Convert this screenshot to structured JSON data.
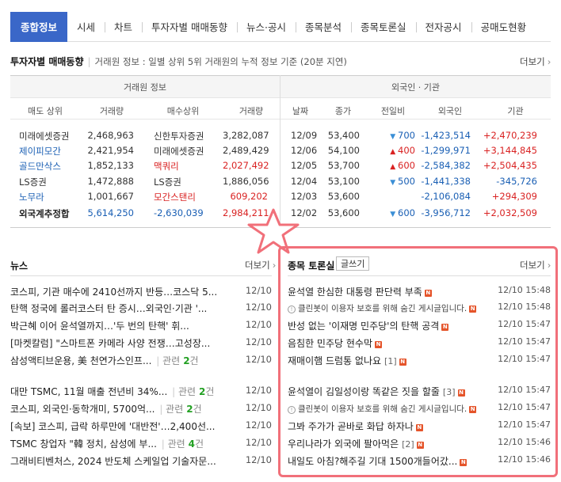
{
  "tabs": [
    "종합정보",
    "시세",
    "차트",
    "투자자별 매매동향",
    "뉴스·공시",
    "종목분석",
    "종목토론실",
    "전자공시",
    "공매도현황"
  ],
  "investor": {
    "title": "투자자별 매매동향",
    "desc": "거래원 정보 : 일별 상위 5위 거래원의 누적 정보 기준 (20분 지연)",
    "more": "더보기",
    "left_header": "거래원 정보",
    "right_header": "외국인 · 기관",
    "cols_left": [
      "매도 상위",
      "거래량",
      "매수상위",
      "거래량"
    ],
    "cols_right": [
      "날짜",
      "종가",
      "전일비",
      "외국인",
      "기관"
    ],
    "broker_rows": [
      {
        "sell": "미래에셋증권",
        "sv": "2,468,963",
        "buy": "신한투자증권",
        "bv": "3,282,087"
      },
      {
        "sell": "제이피모간",
        "sv": "2,421,954",
        "buy": "미래에셋증권",
        "bv": "2,489,429"
      },
      {
        "sell": "골드만삭스",
        "sv": "1,852,133",
        "buy": "맥쿼리",
        "bv": "2,027,492"
      },
      {
        "sell": "LS증권",
        "sv": "1,472,888",
        "buy": "LS증권",
        "bv": "1,886,056"
      },
      {
        "sell": "노무라",
        "sv": "1,001,667",
        "buy": "모간스탠리",
        "bv": "609,202"
      },
      {
        "sell": "외국계추정합",
        "sv": "5,614,250",
        "buy": "-2,630,039",
        "bv": "2,984,211"
      }
    ],
    "daily_rows": [
      {
        "date": "12/09",
        "close": "53,400",
        "dir": "down",
        "chg": "700",
        "foreign": "-1,423,514",
        "inst": "+2,470,239"
      },
      {
        "date": "12/06",
        "close": "54,100",
        "dir": "up",
        "chg": "400",
        "foreign": "-1,299,971",
        "inst": "+3,144,845"
      },
      {
        "date": "12/05",
        "close": "53,700",
        "dir": "up",
        "chg": "600",
        "foreign": "-2,584,382",
        "inst": "+2,504,435"
      },
      {
        "date": "12/04",
        "close": "53,100",
        "dir": "down",
        "chg": "500",
        "foreign": "-1,441,338",
        "inst": "-345,726"
      },
      {
        "date": "12/03",
        "close": "53,600",
        "dir": "none",
        "chg": "",
        "foreign": "-2,106,084",
        "inst": "+294,309"
      },
      {
        "date": "12/02",
        "close": "53,600",
        "dir": "down",
        "chg": "600",
        "foreign": "-3,956,712",
        "inst": "+2,032,509"
      }
    ]
  },
  "news": {
    "title": "뉴스",
    "more": "더보기",
    "items": [
      {
        "title": "코스피, 기관 매수에 2410선까지 반등…코스닥 5...",
        "rel": "",
        "date": "12/10"
      },
      {
        "title": "탄핵 정국에 롤러코스터 탄 증시…외국인·기관 '...",
        "rel": "",
        "date": "12/10"
      },
      {
        "title": "박근혜 이어 윤석열까지…'두 번의 탄핵' 휘...",
        "rel": "",
        "date": "12/10"
      },
      {
        "title": "[마켓칼럼] \"스마트폰 카메라 사양 전쟁…고성장...",
        "rel": "",
        "date": "12/10"
      },
      {
        "title": "삼성액티브운용, 美 천연가스인프...",
        "rel": "2",
        "date": "12/10"
      },
      {
        "title": "대만 TSMC, 11월 매출 전년비 34%...",
        "rel": "2",
        "date": "12/10"
      },
      {
        "title": "코스피, 외국인·동학개미, 5700억...",
        "rel": "2",
        "date": "12/10"
      },
      {
        "title": "[속보] 코스피, 급락 하루만에 '대반전'…2,400선...",
        "rel": "",
        "date": "12/10"
      },
      {
        "title": "TSMC 창업자 \"韓 정치, 삼성에 부...",
        "rel": "4",
        "date": "12/10"
      },
      {
        "title": "그래비티벤처스, 2024 반도체 스케일업 기술자문...",
        "rel": "",
        "date": "12/10"
      }
    ],
    "rel_label": "관련",
    "rel_unit": "건"
  },
  "forum": {
    "title": "종목 토론실",
    "write": "글쓰기",
    "more": "더보기",
    "new_badge": "N",
    "items": [
      {
        "title": "윤석열 한심한 대통령 판단력 부족",
        "cnt": "",
        "hidden": false,
        "date": "12/10 15:48"
      },
      {
        "title": "클린봇이 이용자 보호를 위해 숨긴 게시글입니다.",
        "cnt": "",
        "hidden": true,
        "date": "12/10 15:48"
      },
      {
        "title": "반성 없는 '이재명 민주당'의 탄핵 공격",
        "cnt": "",
        "hidden": false,
        "date": "12/10 15:47"
      },
      {
        "title": "음침한 민주당 현수막",
        "cnt": "",
        "hidden": false,
        "date": "12/10 15:47"
      },
      {
        "title": "재매이햄 드럼통 없나요",
        "cnt": "[1]",
        "hidden": false,
        "date": "12/10 15:47"
      },
      {
        "title": "윤석열이 김일성이랑 똑같은 짓을 할줄",
        "cnt": "[3]",
        "hidden": false,
        "date": "12/10 15:47"
      },
      {
        "title": "클린봇이 이용자 보호를 위해 숨긴 게시글입니다.",
        "cnt": "",
        "hidden": true,
        "date": "12/10 15:47"
      },
      {
        "title": "그봐 주가가 곧바로 화답 하자나",
        "cnt": "",
        "hidden": false,
        "date": "12/10 15:47"
      },
      {
        "title": "우리나라가 외국에 팔아먹은",
        "cnt": "[2]",
        "hidden": false,
        "date": "12/10 15:46"
      },
      {
        "title": "내일도 아침?해주길 기대 1500개들어갔...",
        "cnt": "",
        "hidden": false,
        "date": "12/10 15:46"
      }
    ]
  },
  "colors": {
    "accent": "#3a67c8",
    "up": "#d92222",
    "down": "#1a5fb4",
    "highlight": "#f1707a"
  }
}
